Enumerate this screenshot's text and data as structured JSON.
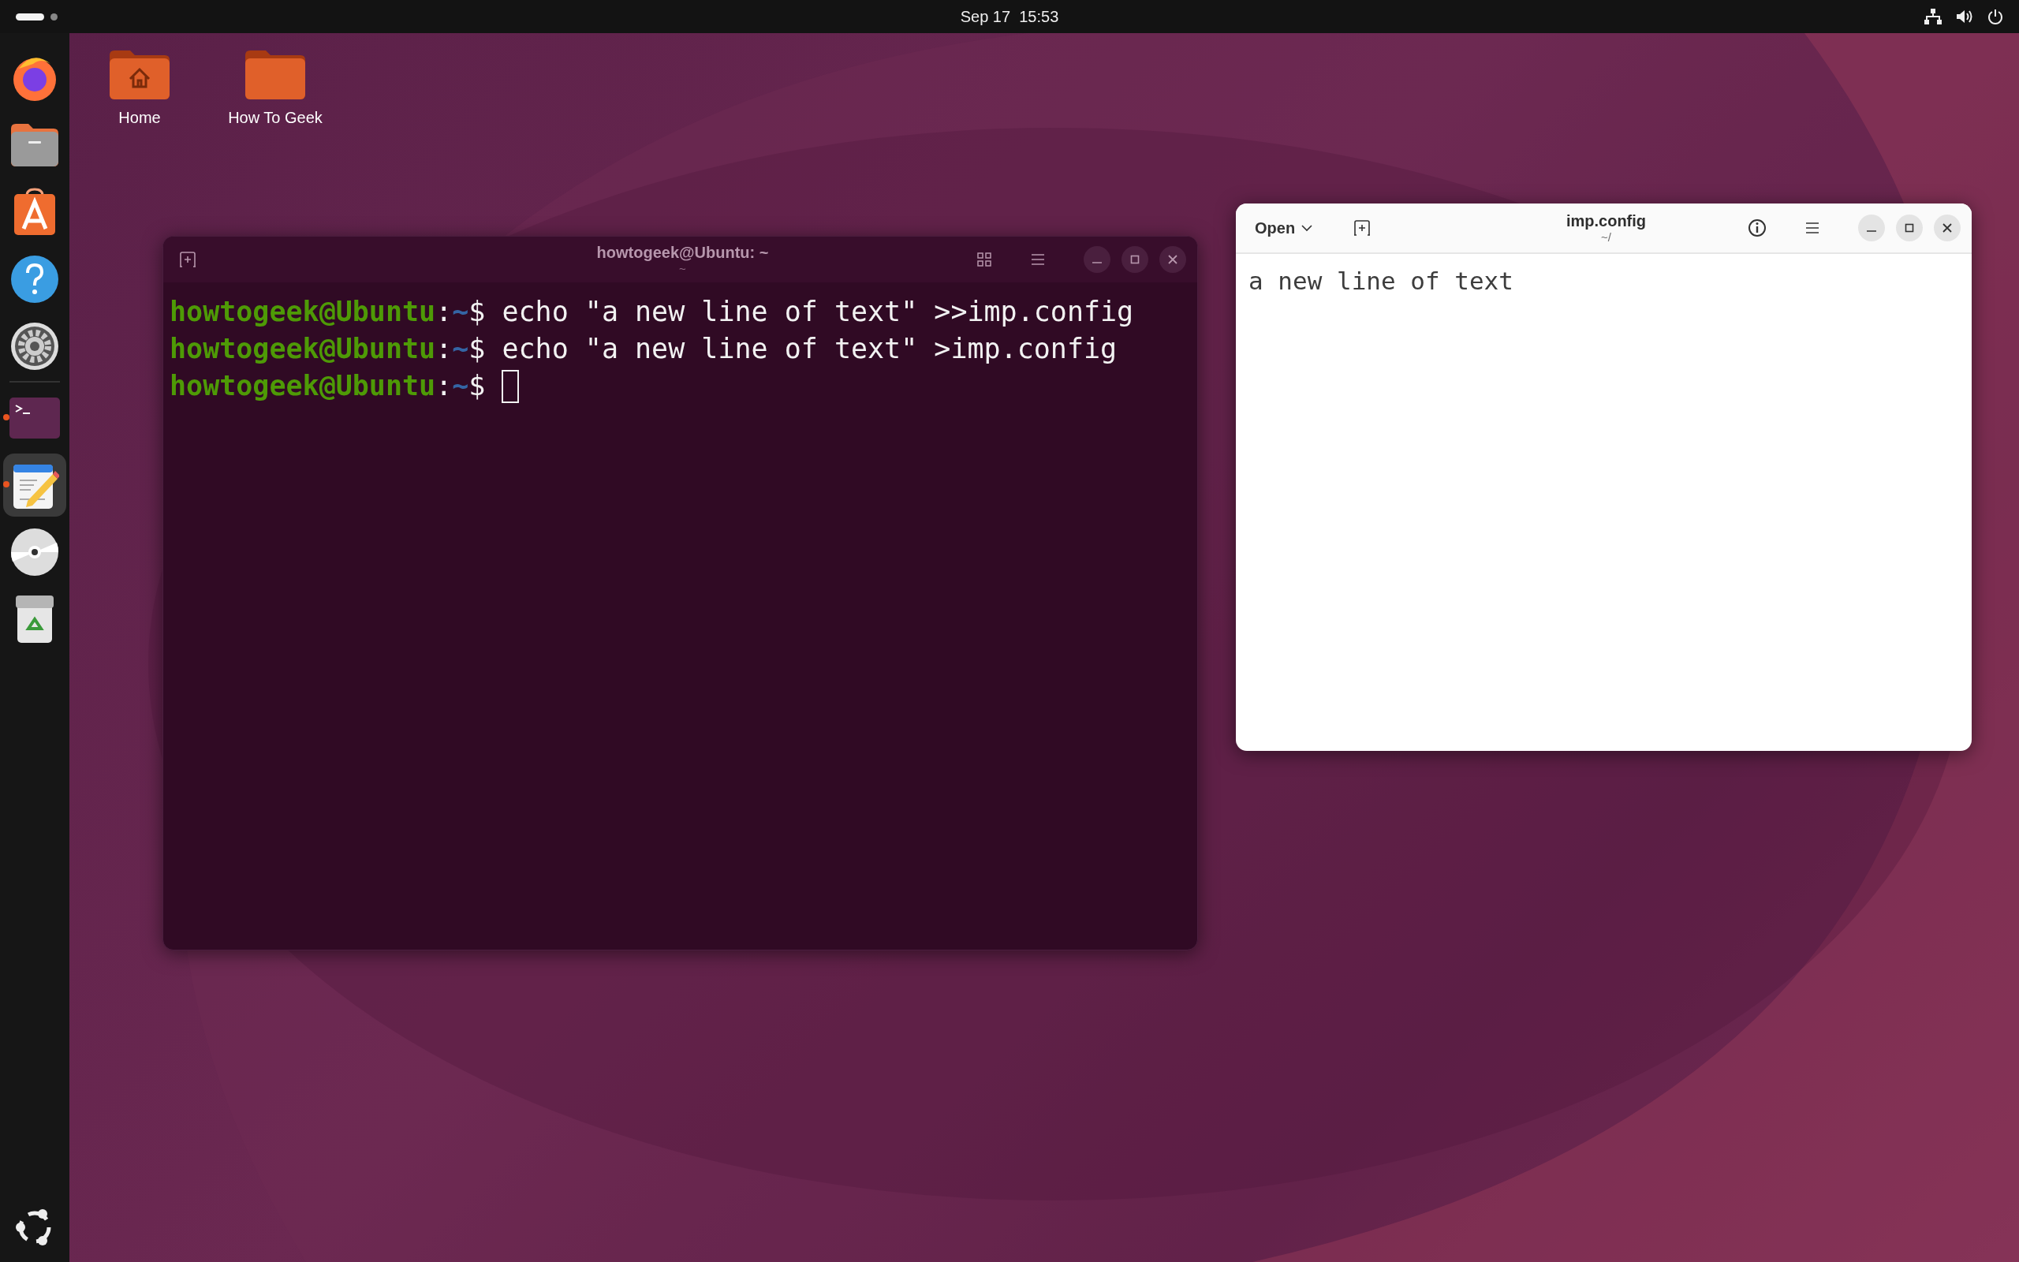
{
  "top_bar": {
    "workspaces": [
      {
        "selected": true
      },
      {
        "selected": false
      }
    ],
    "clock": "Sep 17  15:53"
  },
  "dock": {
    "items": [
      {
        "kind": "browser",
        "running": false,
        "selected": false
      },
      {
        "kind": "files",
        "running": false,
        "selected": false
      },
      {
        "kind": "store",
        "running": false,
        "selected": false
      },
      {
        "kind": "help",
        "running": false,
        "selected": false
      },
      {
        "kind": "settings",
        "running": false,
        "selected": false
      },
      {
        "kind": "terminal",
        "running": true,
        "selected": false
      },
      {
        "kind": "editor",
        "running": true,
        "selected": true
      },
      {
        "kind": "disc",
        "running": false,
        "selected": false
      },
      {
        "kind": "trash",
        "running": false,
        "selected": false
      }
    ]
  },
  "desktop_icons": [
    {
      "kind": "home",
      "label": "Home"
    },
    {
      "kind": "folder",
      "label": "How To Geek"
    }
  ],
  "terminal": {
    "title": "howtogeek@Ubuntu: ~",
    "subtitle": "~",
    "lines": [
      {
        "user": "howtogeek@Ubuntu",
        "separator": ":",
        "path": "~",
        "symbol": "$ ",
        "command": "echo \"a new line of text\" >>imp.config",
        "cursor": false
      },
      {
        "user": "howtogeek@Ubuntu",
        "separator": ":",
        "path": "~",
        "symbol": "$ ",
        "command": "echo \"a new line of text\" >imp.config",
        "cursor": false
      },
      {
        "user": "howtogeek@Ubuntu",
        "separator": ":",
        "path": "~",
        "symbol": "$ ",
        "cursor": true
      }
    ]
  },
  "editor": {
    "open_button": "Open",
    "title": "imp.config",
    "subtitle": "~/",
    "content": "a new line of text"
  }
}
